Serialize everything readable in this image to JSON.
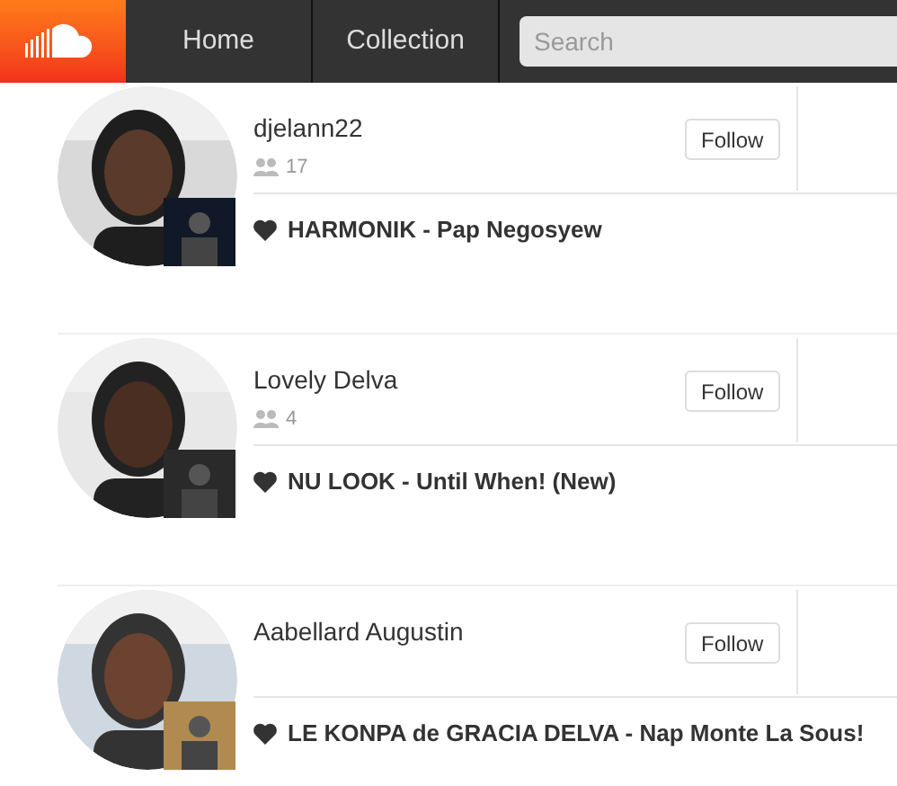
{
  "header": {
    "nav": [
      {
        "label": "Home"
      },
      {
        "label": "Collection"
      }
    ],
    "search": {
      "placeholder": "Search"
    }
  },
  "users": [
    {
      "name": "djelann22",
      "followers": "17",
      "follow_label": "Follow",
      "track": "HARMONIK - Pap Negosyew"
    },
    {
      "name": "Lovely Delva",
      "followers": "4",
      "follow_label": "Follow",
      "track": "NU LOOK - Until When! (New)"
    },
    {
      "name": "Aabellard Augustin",
      "follow_label": "Follow",
      "track": "LE KONPA de GRACIA DELVA - Nap Monte La Sous!"
    }
  ]
}
